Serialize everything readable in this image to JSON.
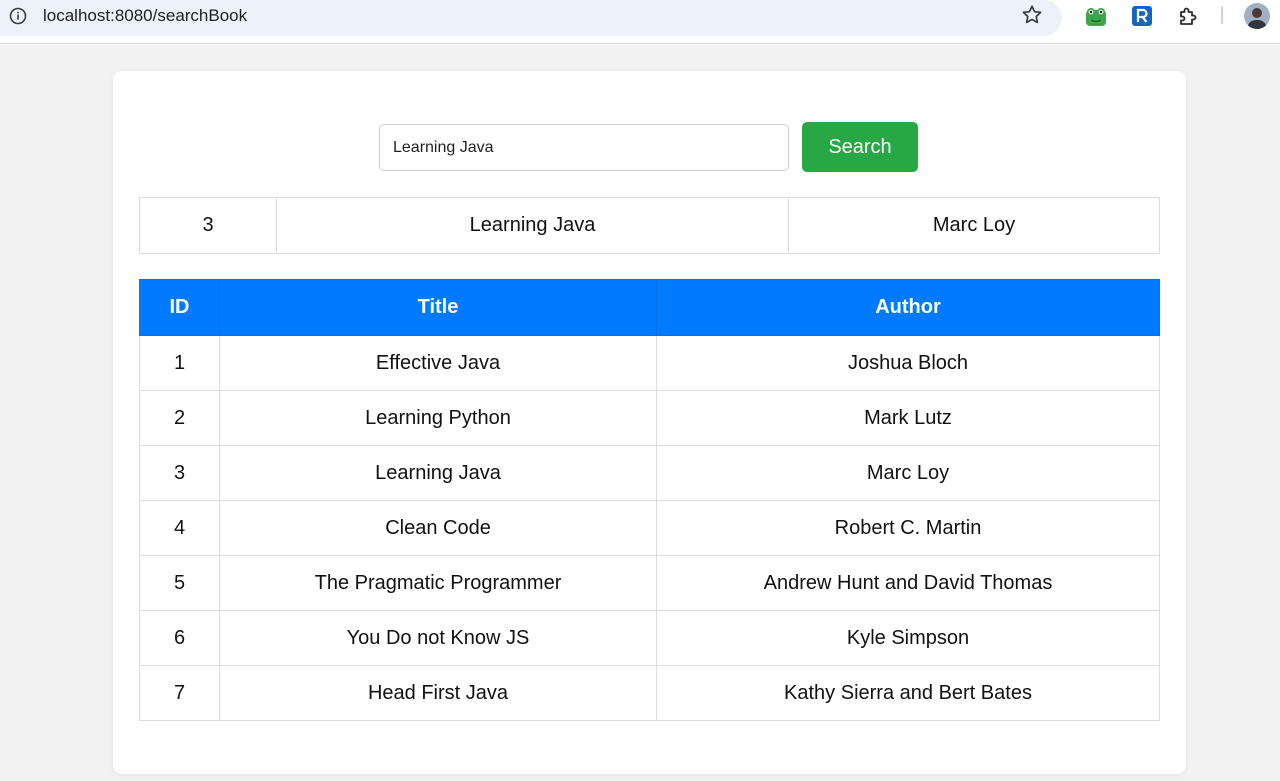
{
  "browser": {
    "url": "localhost:8080/searchBook"
  },
  "search": {
    "value": "Learning Java",
    "button_label": "Search"
  },
  "result": {
    "id": "3",
    "title": "Learning Java",
    "author": "Marc Loy"
  },
  "table": {
    "headers": [
      "ID",
      "Title",
      "Author"
    ],
    "rows": [
      {
        "id": "1",
        "title": "Effective Java",
        "author": "Joshua Bloch"
      },
      {
        "id": "2",
        "title": "Learning Python",
        "author": "Mark Lutz"
      },
      {
        "id": "3",
        "title": "Learning Java",
        "author": "Marc Loy"
      },
      {
        "id": "4",
        "title": "Clean Code",
        "author": "Robert C. Martin"
      },
      {
        "id": "5",
        "title": "The Pragmatic Programmer",
        "author": "Andrew Hunt and David Thomas"
      },
      {
        "id": "6",
        "title": "You Do not Know JS",
        "author": "Kyle Simpson"
      },
      {
        "id": "7",
        "title": "Head First Java",
        "author": "Kathy Sierra and Bert Bates"
      }
    ]
  },
  "colors": {
    "header_bg": "#007bff",
    "button_bg": "#28a745",
    "page_bg": "#f2f2f2"
  },
  "icons": [
    "site-info-icon",
    "bookmark-star-icon",
    "frog-extension-icon",
    "r-extension-icon",
    "extensions-puzzle-icon",
    "profile-avatar"
  ]
}
